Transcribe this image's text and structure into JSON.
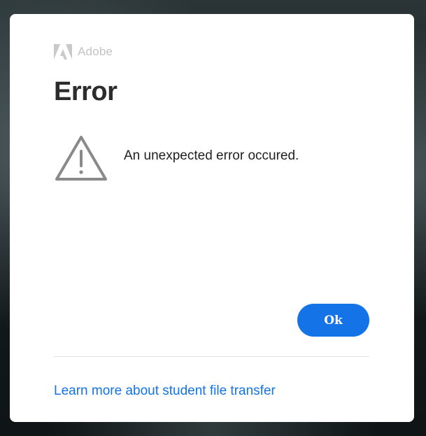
{
  "brand": {
    "name": "Adobe",
    "logo_icon": "adobe-logo-icon"
  },
  "dialog": {
    "title": "Error",
    "warning_icon": "warning-triangle-icon",
    "message": "An unexpected error occured.",
    "ok_label": "Ok",
    "learn_more_link": "Learn more about student file transfer"
  },
  "colors": {
    "accent": "#1473e6",
    "title_text": "#2c2c2c",
    "brand_text": "#c3c3c3",
    "icon_gray": "#8a8a8a",
    "dialog_background": "#ffffff"
  }
}
